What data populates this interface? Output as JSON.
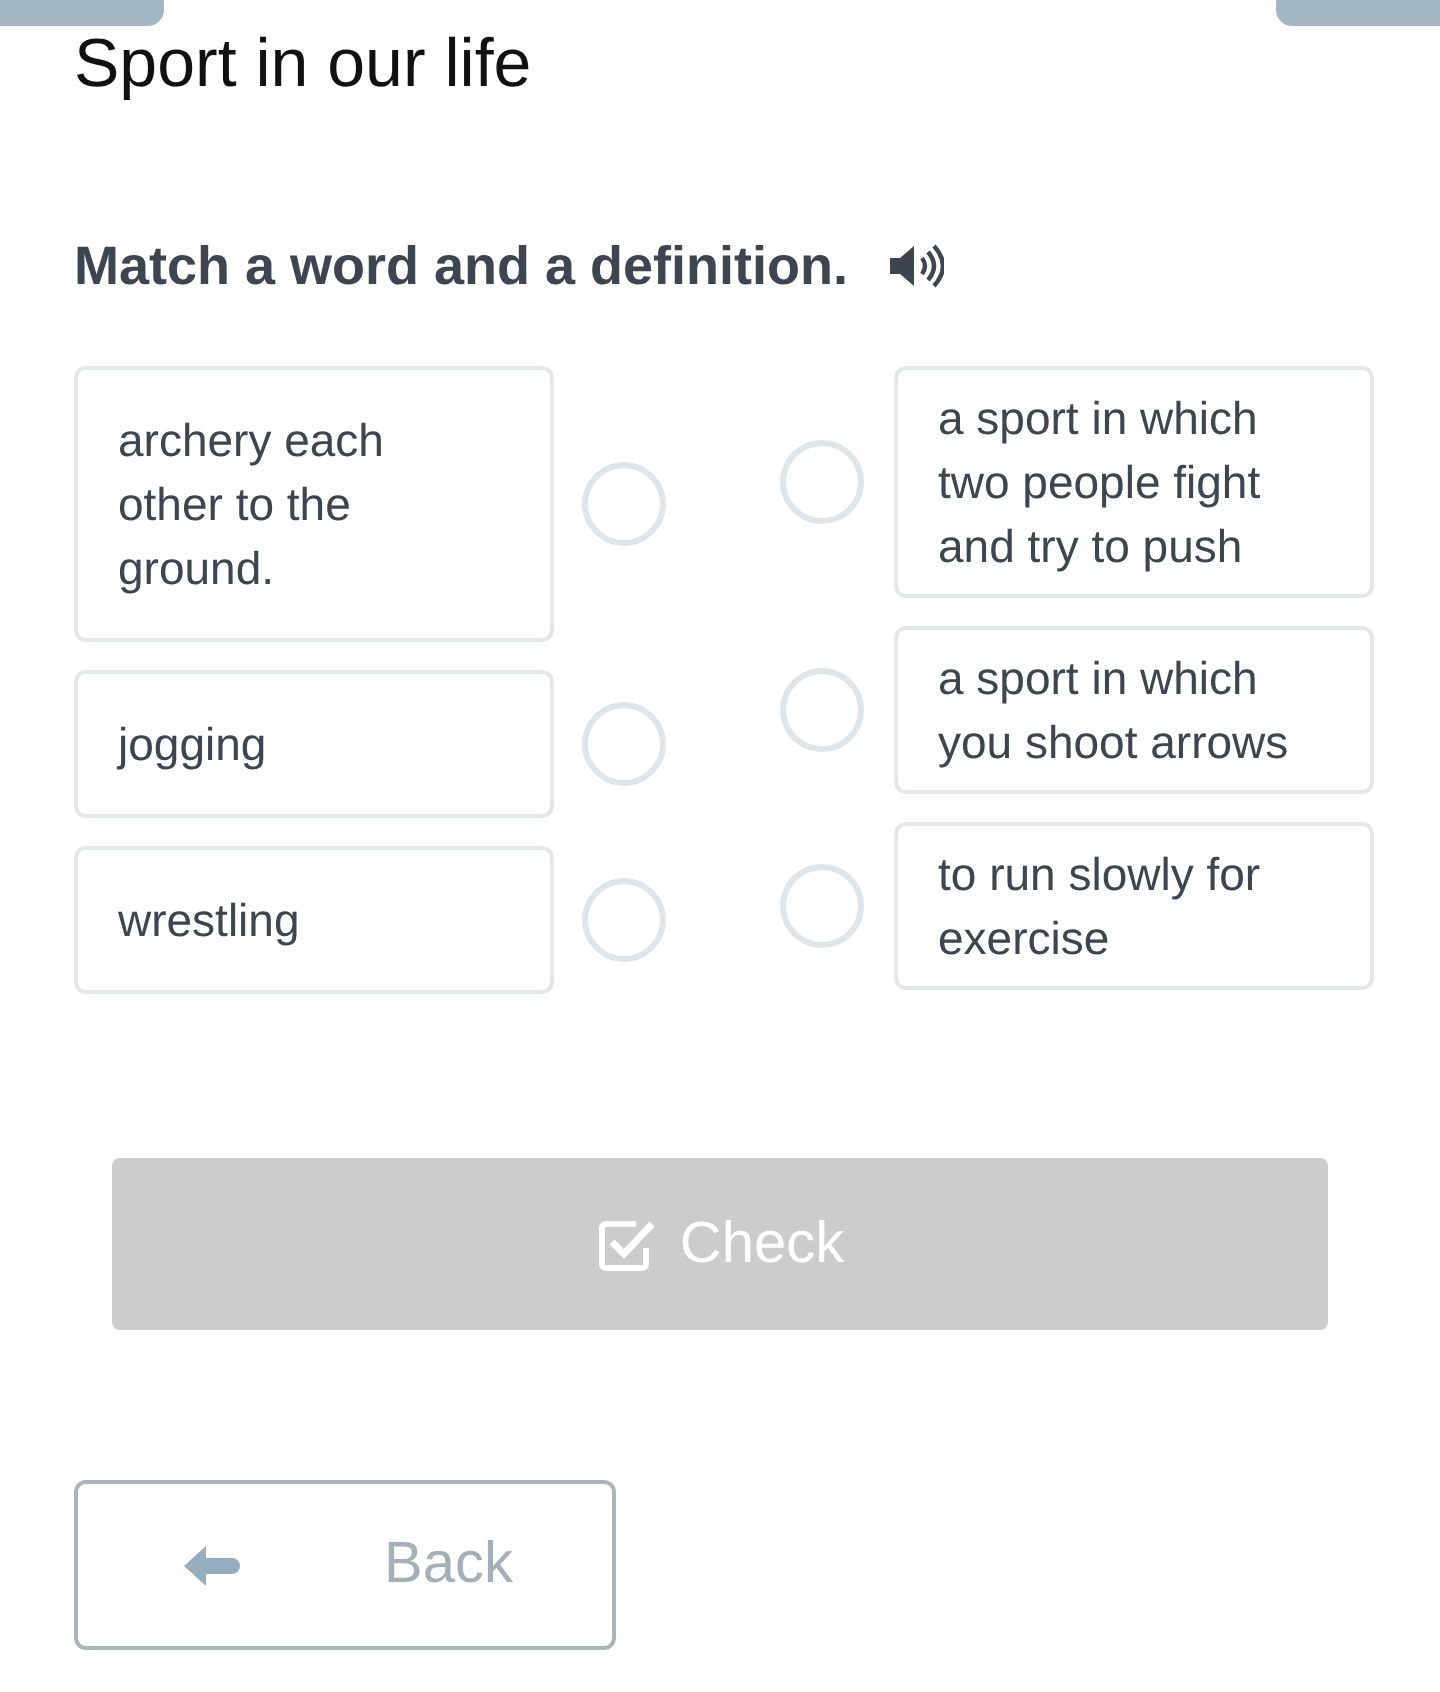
{
  "title": "Sport in our life",
  "instruction": "Match a word and a definition.",
  "words": [
    {
      "text": "archery each other to the ground.",
      "selected": false
    },
    {
      "text": "jogging",
      "selected": false
    },
    {
      "text": "wrestling",
      "selected": false
    }
  ],
  "definitions": [
    {
      "text": "a sport in which two people fight and try to push",
      "selected": false
    },
    {
      "text": "a sport in which you shoot arrows",
      "selected": false
    },
    {
      "text": "to run slowly for exercise",
      "selected": false
    }
  ],
  "check_button": {
    "label": "Check",
    "disabled": true
  },
  "back_button": {
    "label": "Back"
  }
}
